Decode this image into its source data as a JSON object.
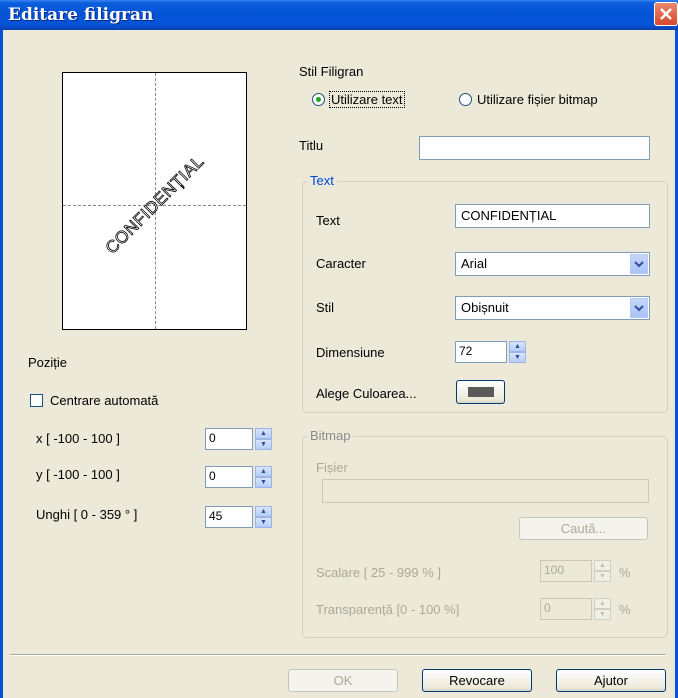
{
  "window": {
    "title": "Editare filigran"
  },
  "preview": {
    "watermark_text": "CONFIDENȚIAL"
  },
  "position": {
    "heading": "Poziție",
    "auto_center_label": "Centrare automată",
    "auto_center_checked": false,
    "x_label": "x [ -100  -  100 ]",
    "x_value": "0",
    "y_label": "y [ -100  -  100 ]",
    "y_value": "0",
    "angle_label": "Unghi [ 0 - 359 ° ]",
    "angle_value": "45"
  },
  "style": {
    "heading": "Stil Filigran",
    "option_text": "Utilizare text",
    "option_bitmap": "Utilizare fișier bitmap",
    "selected": "text"
  },
  "title_field": {
    "label": "Titlu",
    "value": ""
  },
  "text_group": {
    "heading": "Text",
    "text_label": "Text",
    "text_value": "CONFIDENȚIAL",
    "font_label": "Caracter",
    "font_value": "Arial",
    "style_label": "Stil",
    "style_value": "Obișnuit",
    "size_label": "Dimensiune",
    "size_value": "72",
    "color_label": "Alege Culoarea...",
    "color": "#5a5a5a"
  },
  "bitmap_group": {
    "heading": "Bitmap",
    "file_label": "Fișier",
    "file_value": "",
    "browse_label": "Caută...",
    "scale_label": "Scalare [ 25 - 999 % ]",
    "scale_value": "100",
    "scale_unit": "%",
    "transparency_label": "Transparență [0 - 100 %]",
    "transparency_value": "0",
    "transparency_unit": "%"
  },
  "buttons": {
    "ok": "OK",
    "cancel": "Revocare",
    "help": "Ajutor"
  },
  "colors": {
    "titlebar": "#0553d6",
    "group_title": "#0046d5",
    "dialog_bg": "#ece9d8"
  }
}
